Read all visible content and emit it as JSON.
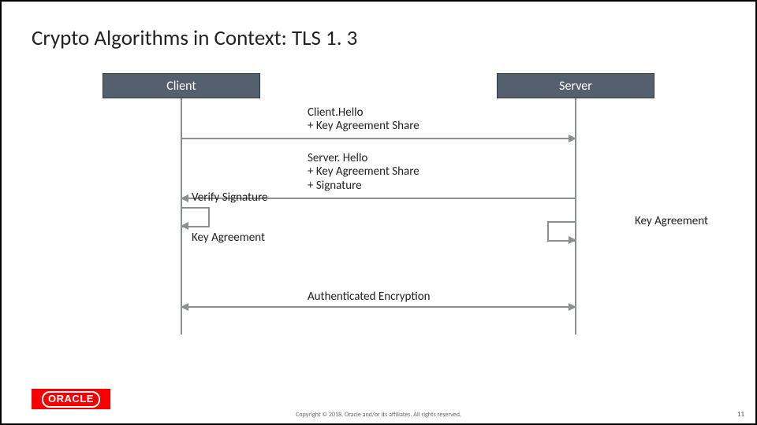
{
  "title": "Crypto Algorithms in Context: TLS 1. 3",
  "actors": {
    "client": "Client",
    "server": "Server"
  },
  "messages": {
    "client_hello": "Client.Hello\n+ Key Agreement Share",
    "server_hello": "Server. Hello\n+ Key Agreement Share\n+ Signature",
    "verify_signature": "Verify Signature",
    "key_agreement_client": "Key Agreement",
    "key_agreement_server": "Key Agreement",
    "auth_encryption": "Authenticated Encryption"
  },
  "footer": "Copyright © 2018, Oracle and/or its affiliates. All rights reserved.",
  "page": "11",
  "logo": "ORACLE"
}
